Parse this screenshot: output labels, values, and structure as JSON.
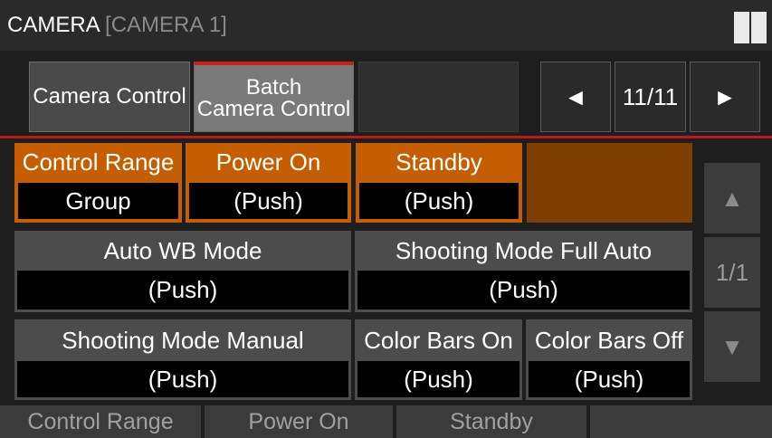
{
  "title": {
    "main": "CAMERA",
    "sub": "[CAMERA 1]"
  },
  "tabs": [
    {
      "label": "Camera Control"
    },
    {
      "label_line1": "Batch",
      "label_line2": "Camera Control"
    }
  ],
  "pagination": {
    "prev": "◄",
    "page": "11/11",
    "next": "►"
  },
  "controls": [
    {
      "header": "Control Range",
      "value": "Group"
    },
    {
      "header": "Power On",
      "value": "(Push)"
    },
    {
      "header": "Standby",
      "value": "(Push)"
    },
    {
      "header": "Auto WB Mode",
      "value": "(Push)"
    },
    {
      "header": "Shooting Mode Full Auto",
      "value": "(Push)"
    },
    {
      "header": "Shooting Mode Manual",
      "value": "(Push)"
    },
    {
      "header": "Color Bars On",
      "value": "(Push)"
    },
    {
      "header": "Color Bars Off",
      "value": "(Push)"
    }
  ],
  "scroll": {
    "up": "▲",
    "page": "1/1",
    "down": "▼"
  },
  "bottom": [
    {
      "label": "Control Range"
    },
    {
      "label": "Power On"
    },
    {
      "label": "Standby"
    }
  ],
  "colors": {
    "accent_orange": "#c45e00",
    "tab_indicator_red": "#cc1f1f",
    "empty_orange": "#7f3f00"
  }
}
